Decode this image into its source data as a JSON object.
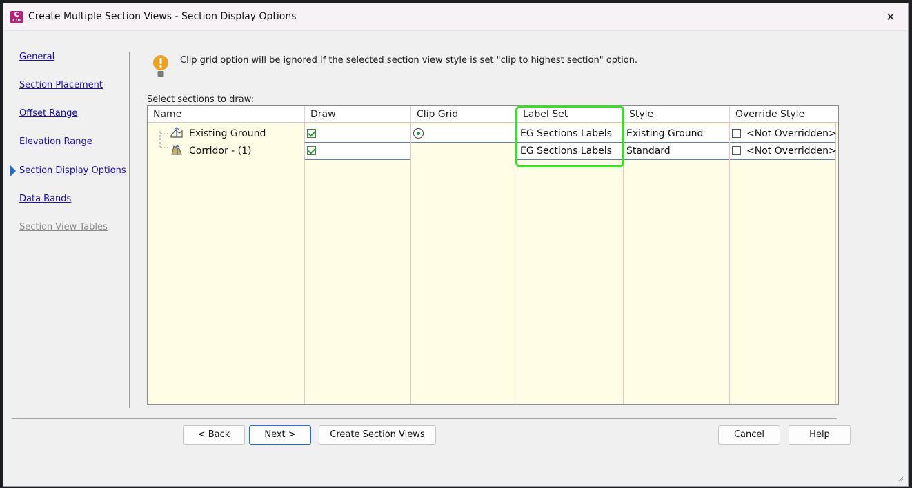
{
  "window": {
    "title": "Create Multiple Section Views - Section Display Options",
    "app_icon_letter": "C",
    "app_icon_sub": "C3D",
    "close_glyph": "✕"
  },
  "sidebar": {
    "items": [
      {
        "label": "General",
        "active": false,
        "enabled": true
      },
      {
        "label": "Section Placement",
        "active": false,
        "enabled": true
      },
      {
        "label": "Offset Range",
        "active": false,
        "enabled": true
      },
      {
        "label": "Elevation Range",
        "active": false,
        "enabled": true
      },
      {
        "label": "Section Display Options",
        "active": true,
        "enabled": true
      },
      {
        "label": "Data Bands",
        "active": false,
        "enabled": true
      },
      {
        "label": "Section View Tables",
        "active": false,
        "enabled": false
      }
    ]
  },
  "warning": {
    "icon": "warning-bulb-icon",
    "text": "Clip grid option will be ignored if the selected section view style is set \"clip to highest section\" option."
  },
  "grid": {
    "caption": "Select sections to draw:",
    "columns": [
      "Name",
      "Draw",
      "Clip Grid",
      "Label Set",
      "Style",
      "Override Style"
    ],
    "rows": [
      {
        "name": "Existing Ground",
        "icon": "surface-section-icon",
        "draw": true,
        "clip_grid": true,
        "label_set": "EG Sections Labels",
        "style": "Existing Ground",
        "override": false,
        "override_style": "<Not Overridden>"
      },
      {
        "name": "Corridor - (1)",
        "icon": "corridor-section-icon",
        "draw": true,
        "clip_grid": false,
        "label_set": "EG Sections Labels",
        "style": "Standard",
        "override": false,
        "override_style": "<Not Overridden>"
      }
    ]
  },
  "buttons": {
    "back": "< Back",
    "next": "Next >",
    "create": "Create Section Views",
    "cancel": "Cancel",
    "help": "Help"
  },
  "colors": {
    "highlight": "#3cdc28",
    "link": "#1a0dab",
    "grid_background": "#fffde6",
    "active_arrow": "#1a6fd4"
  }
}
